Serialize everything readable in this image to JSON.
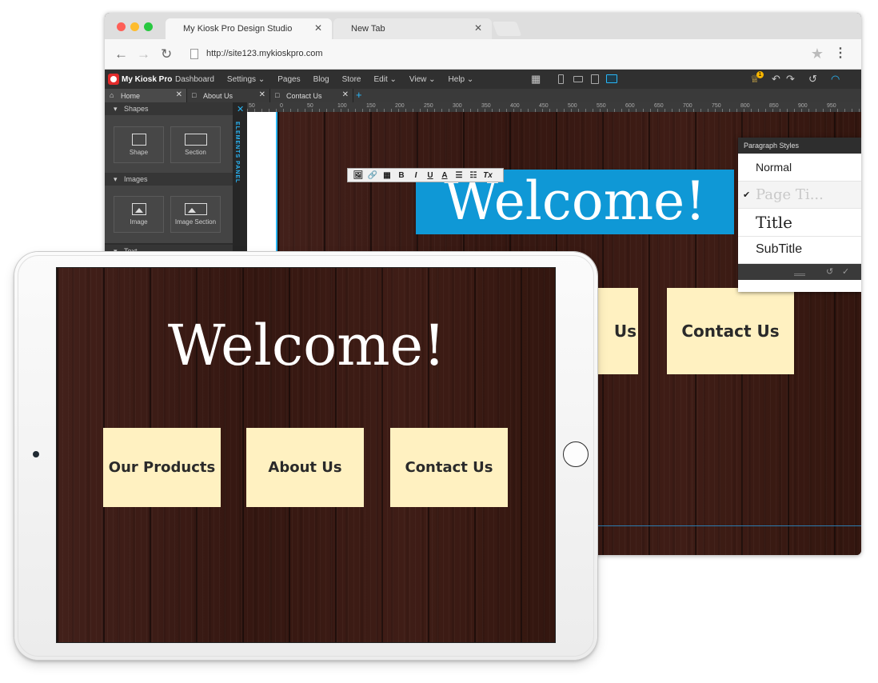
{
  "browser": {
    "tabs": [
      {
        "label": "My Kiosk Pro Design Studio",
        "close": "✕"
      },
      {
        "label": "New Tab",
        "close": "✕"
      }
    ],
    "url": "http://site123.mykioskpro.com"
  },
  "app": {
    "logo_text": "My Kiosk Pro",
    "menu": [
      "Dashboard",
      "Settings ⌄",
      "Pages",
      "Blog",
      "Store",
      "Edit ⌄",
      "View ⌄",
      "Help ⌄"
    ],
    "notification_count": "1"
  },
  "page_tabs": [
    {
      "label": "Home",
      "close": "✕"
    },
    {
      "label": "About Us",
      "close": "✕"
    },
    {
      "label": "Contact Us",
      "close": "✕"
    }
  ],
  "add_tab": "+",
  "elements_panel": {
    "vertical_label": "ELEMENTS PANEL",
    "close": "✕",
    "sections": [
      {
        "title": "Shapes",
        "items": [
          "Shape",
          "Section"
        ]
      },
      {
        "title": "Images",
        "items": [
          "Image",
          "Image Section"
        ]
      },
      {
        "title": "Text",
        "items": []
      }
    ]
  },
  "ruler": [
    "50",
    "0",
    "50",
    "100",
    "150",
    "200",
    "250",
    "300",
    "350",
    "400",
    "450",
    "500",
    "550",
    "600",
    "650",
    "700",
    "750",
    "800",
    "850",
    "900",
    "950"
  ],
  "editor": {
    "heading": "Welcome!",
    "toolbar": [
      "🖼",
      "🔗",
      "▦",
      "B",
      "I",
      "U",
      "A",
      "☰",
      "☷",
      "Tx"
    ],
    "buttons": [
      "Us",
      "Contact Us"
    ]
  },
  "paragraph_styles": {
    "title": "Paragraph Styles",
    "items": [
      {
        "label": "Normal",
        "checked": false
      },
      {
        "label": "Page Ti...",
        "checked": true
      },
      {
        "label": "Title",
        "checked": false
      },
      {
        "label": "SubTitle",
        "checked": false
      }
    ],
    "check": "✔"
  },
  "tablet": {
    "heading": "Welcome!",
    "buttons": [
      "Our Products",
      "About Us",
      "Contact Us"
    ]
  },
  "colors": {
    "accent": "#29b6f6",
    "selection": "#0f98d6",
    "button_bg": "#fff1c1",
    "wood": "#3a1a14"
  }
}
